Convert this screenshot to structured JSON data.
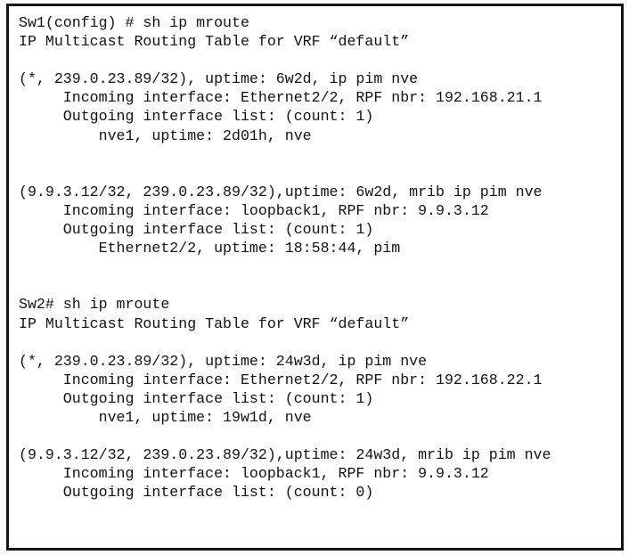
{
  "window": {
    "type": "terminal-output",
    "background_color": "#ffffff",
    "text_color": "#121212",
    "border_color": "#151515"
  },
  "terminal": {
    "sessions": [
      {
        "prompt": "Sw1(config) #",
        "command": "sh ip mroute",
        "table_title": "IP Multicast Routing Table for VRF “default”",
        "entries": [
          {
            "route": "(*, 239.0.23.89/32), uptime: 6w2d, ip pim nve",
            "incoming": "Incoming interface: Ethernet2/2, RPF nbr: 192.168.21.1",
            "oil_header": "Outgoing interface list: (count: 1)",
            "oil_entries": [
              "nve1, uptime: 2d01h, nve"
            ]
          },
          {
            "route": "(9.9.3.12/32, 239.0.23.89/32),uptime: 6w2d, mrib ip pim nve",
            "incoming": "Incoming interface: loopback1, RPF nbr: 9.9.3.12",
            "oil_header": "Outgoing interface list: (count: 1)",
            "oil_entries": [
              "Ethernet2/2, uptime: 18:58:44, pim"
            ]
          }
        ]
      },
      {
        "prompt": "Sw2#",
        "command": "sh ip mroute",
        "table_title": "IP Multicast Routing Table for VRF “default”",
        "entries": [
          {
            "route": "(*, 239.0.23.89/32), uptime: 24w3d, ip pim nve",
            "incoming": "Incoming interface: Ethernet2/2, RPF nbr: 192.168.22.1",
            "oil_header": "Outgoing interface list: (count: 1)",
            "oil_entries": [
              "nve1, uptime: 19w1d, nve"
            ]
          },
          {
            "route": "(9.9.3.12/32, 239.0.23.89/32),uptime: 24w3d, mrib ip pim nve",
            "incoming": "Incoming interface: loopback1, RPF nbr: 9.9.3.12",
            "oil_header": "Outgoing interface list: (count: 0)",
            "oil_entries": []
          }
        ]
      }
    ],
    "lines": [
      "Sw1(config) # sh ip mroute",
      "IP Multicast Routing Table for VRF “default”",
      "",
      "(*, 239.0.23.89/32), uptime: 6w2d, ip pim nve",
      "     Incoming interface: Ethernet2/2, RPF nbr: 192.168.21.1",
      "     Outgoing interface list: (count: 1)",
      "         nve1, uptime: 2d01h, nve",
      "",
      "",
      "(9.9.3.12/32, 239.0.23.89/32),uptime: 6w2d, mrib ip pim nve",
      "     Incoming interface: loopback1, RPF nbr: 9.9.3.12",
      "     Outgoing interface list: (count: 1)",
      "         Ethernet2/2, uptime: 18:58:44, pim",
      "",
      "",
      "Sw2# sh ip mroute",
      "IP Multicast Routing Table for VRF “default”",
      "",
      "(*, 239.0.23.89/32), uptime: 24w3d, ip pim nve",
      "     Incoming interface: Ethernet2/2, RPF nbr: 192.168.22.1",
      "     Outgoing interface list: (count: 1)",
      "         nve1, uptime: 19w1d, nve",
      "",
      "(9.9.3.12/32, 239.0.23.89/32),uptime: 24w3d, mrib ip pim nve",
      "     Incoming interface: loopback1, RPF nbr: 9.9.3.12",
      "     Outgoing interface list: (count: 0)"
    ]
  }
}
